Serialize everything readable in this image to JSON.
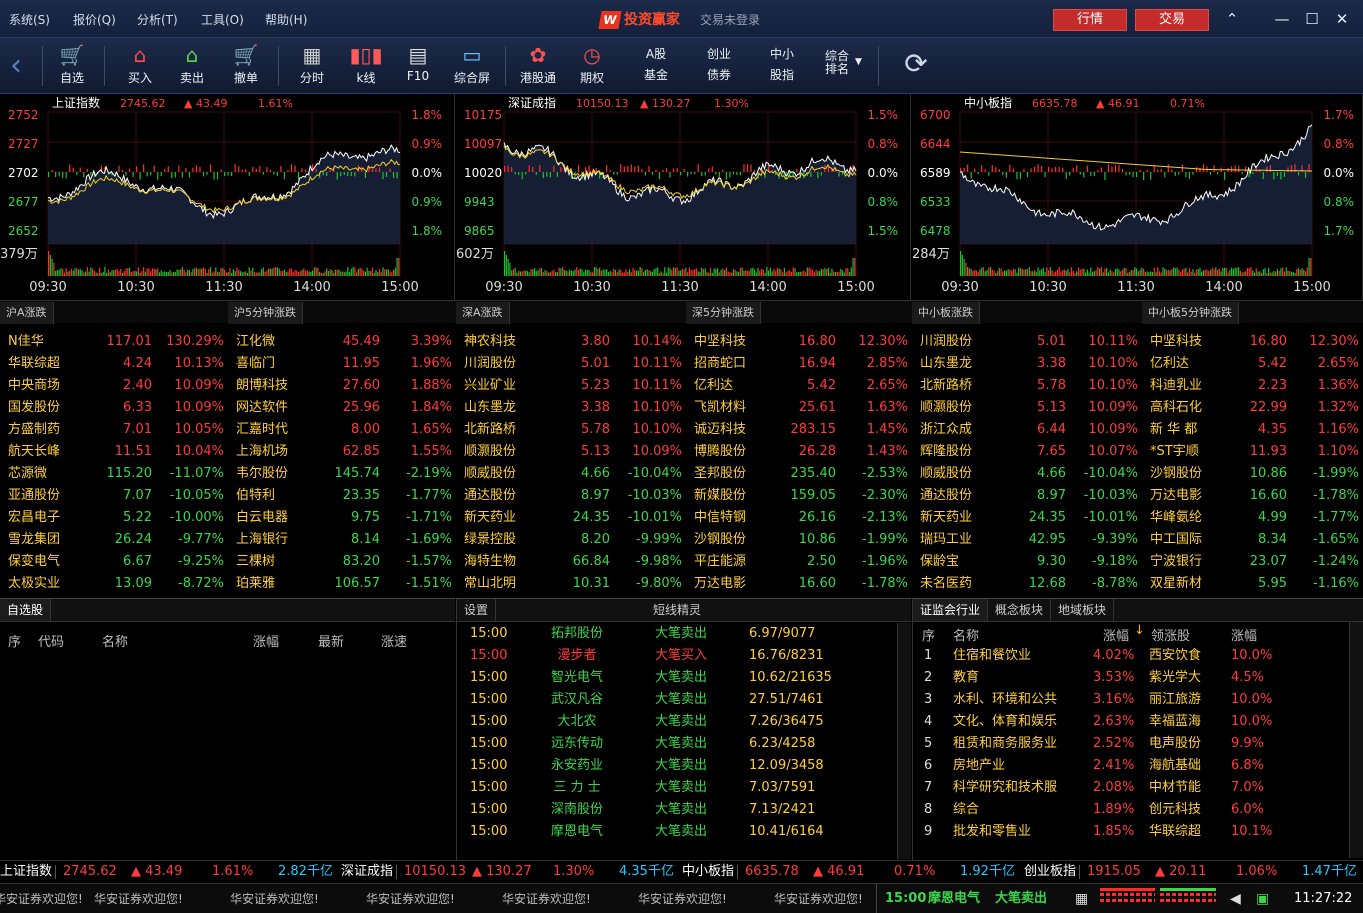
{
  "menu": [
    "系统(S)",
    "报价(Q)",
    "分析(T)",
    "工具(O)",
    "帮助(H)"
  ],
  "app_title": "投资赢家",
  "login_status": "交易未登录",
  "top_buttons": {
    "quote": "行情",
    "trade": "交易"
  },
  "toolbar": {
    "zixuan": "自选",
    "buy": "买入",
    "sell": "卖出",
    "cancel": "撤单",
    "fenshi": "分时",
    "kline": "k线",
    "f10": "F10",
    "zonghe": "综合屏",
    "ganggu": "港股通",
    "qiquan": "期权",
    "a_fund_1": "A股",
    "a_fund_2": "基金",
    "cy_1": "创业",
    "cy_2": "债券",
    "zx_1": "中小",
    "zx_2": "股指",
    "zh_1": "综合",
    "zh_2": "排名"
  },
  "charts": [
    {
      "name": "上证指数",
      "value": "2745.62",
      "change": "▲ 43.49",
      "pct": "1.61%",
      "left_ticks": [
        "2752",
        "2727",
        "2702",
        "2677",
        "2652"
      ],
      "right_ticks": [
        "1.8%",
        "0.9%",
        "0.0%",
        "0.9%",
        "1.8%"
      ],
      "volume": "379万",
      "times": [
        "09:30",
        "10:30",
        "11:30",
        "14:00",
        "15:00"
      ]
    },
    {
      "name": "深证成指",
      "value": "10150.13",
      "change": "▲ 130.27",
      "pct": "1.30%",
      "left_ticks": [
        "10175",
        "10097",
        "10020",
        "9943",
        "9865"
      ],
      "right_ticks": [
        "1.5%",
        "0.8%",
        "0.0%",
        "0.8%",
        "1.5%"
      ],
      "volume": "602万",
      "times": [
        "09:30",
        "10:30",
        "11:30",
        "14:00",
        "15:00"
      ]
    },
    {
      "name": "中小板指",
      "value": "6635.78",
      "change": "▲ 46.91",
      "pct": "0.71%",
      "left_ticks": [
        "6700",
        "6644",
        "6589",
        "6533",
        "6478"
      ],
      "right_ticks": [
        "1.7%",
        "0.8%",
        "0.0%",
        "0.8%",
        "1.7%"
      ],
      "volume": "284万",
      "times": [
        "09:30",
        "10:30",
        "11:30",
        "14:00",
        "15:00"
      ]
    }
  ],
  "tables": [
    {
      "title": "沪A涨跌",
      "rows": [
        [
          "N佳华",
          "117.01",
          "130.29%",
          "up"
        ],
        [
          "华联综超",
          "4.24",
          "10.13%",
          "up"
        ],
        [
          "中央商场",
          "2.40",
          "10.09%",
          "up"
        ],
        [
          "国发股份",
          "6.33",
          "10.09%",
          "up"
        ],
        [
          "方盛制药",
          "7.01",
          "10.05%",
          "up"
        ],
        [
          "航天长峰",
          "11.51",
          "10.04%",
          "up"
        ],
        [
          "芯源微",
          "115.20",
          "-11.07%",
          "dn"
        ],
        [
          "亚通股份",
          "7.07",
          "-10.05%",
          "dn"
        ],
        [
          "宏昌电子",
          "5.22",
          "-10.00%",
          "dn"
        ],
        [
          "雪龙集团",
          "26.24",
          "-9.77%",
          "dn"
        ],
        [
          "保变电气",
          "6.67",
          "-9.25%",
          "dn"
        ],
        [
          "太极实业",
          "13.09",
          "-8.72%",
          "dn"
        ]
      ]
    },
    {
      "title": "沪5分钟涨跌",
      "rows": [
        [
          "江化微",
          "45.49",
          "3.39%",
          "up"
        ],
        [
          "喜临门",
          "11.95",
          "1.96%",
          "up"
        ],
        [
          "朗博科技",
          "27.60",
          "1.88%",
          "up"
        ],
        [
          "网达软件",
          "25.96",
          "1.84%",
          "up"
        ],
        [
          "汇嘉时代",
          "8.00",
          "1.65%",
          "up"
        ],
        [
          "上海机场",
          "62.85",
          "1.55%",
          "up"
        ],
        [
          "韦尔股份",
          "145.74",
          "-2.19%",
          "dn"
        ],
        [
          "伯特利",
          "23.35",
          "-1.77%",
          "dn"
        ],
        [
          "白云电器",
          "9.75",
          "-1.71%",
          "dn"
        ],
        [
          "上海银行",
          "8.14",
          "-1.69%",
          "dn"
        ],
        [
          "三棵树",
          "83.20",
          "-1.57%",
          "dn"
        ],
        [
          "珀莱雅",
          "106.57",
          "-1.51%",
          "dn"
        ]
      ]
    },
    {
      "title": "深A涨跌",
      "rows": [
        [
          "神农科技",
          "3.80",
          "10.14%",
          "up"
        ],
        [
          "川润股份",
          "5.01",
          "10.11%",
          "up"
        ],
        [
          "兴业矿业",
          "5.23",
          "10.11%",
          "up"
        ],
        [
          "山东墨龙",
          "3.38",
          "10.10%",
          "up"
        ],
        [
          "北新路桥",
          "5.78",
          "10.10%",
          "up"
        ],
        [
          "顺灏股份",
          "5.13",
          "10.09%",
          "up"
        ],
        [
          "顺威股份",
          "4.66",
          "-10.04%",
          "dn"
        ],
        [
          "通达股份",
          "8.97",
          "-10.03%",
          "dn"
        ],
        [
          "新天药业",
          "24.35",
          "-10.01%",
          "dn"
        ],
        [
          "绿景控股",
          "8.20",
          "-9.99%",
          "dn"
        ],
        [
          "海特生物",
          "66.84",
          "-9.98%",
          "dn"
        ],
        [
          "常山北明",
          "10.31",
          "-9.80%",
          "dn"
        ]
      ]
    },
    {
      "title": "深5分钟涨跌",
      "rows": [
        [
          "中坚科技",
          "16.80",
          "12.30%",
          "up"
        ],
        [
          "招商蛇口",
          "16.94",
          "2.85%",
          "up"
        ],
        [
          "亿利达",
          "5.42",
          "2.65%",
          "up"
        ],
        [
          "飞凯材料",
          "25.61",
          "1.63%",
          "up"
        ],
        [
          "诚迈科技",
          "283.15",
          "1.45%",
          "up"
        ],
        [
          "博腾股份",
          "26.28",
          "1.43%",
          "up"
        ],
        [
          "圣邦股份",
          "235.40",
          "-2.53%",
          "dn"
        ],
        [
          "新媒股份",
          "159.05",
          "-2.30%",
          "dn"
        ],
        [
          "中信特钢",
          "26.16",
          "-2.13%",
          "dn"
        ],
        [
          "沙钢股份",
          "10.86",
          "-1.99%",
          "dn"
        ],
        [
          "平庄能源",
          "2.50",
          "-1.96%",
          "dn"
        ],
        [
          "万达电影",
          "16.60",
          "-1.78%",
          "dn"
        ]
      ]
    },
    {
      "title": "中小板涨跌",
      "rows": [
        [
          "川润股份",
          "5.01",
          "10.11%",
          "up"
        ],
        [
          "山东墨龙",
          "3.38",
          "10.10%",
          "up"
        ],
        [
          "北新路桥",
          "5.78",
          "10.10%",
          "up"
        ],
        [
          "顺灏股份",
          "5.13",
          "10.09%",
          "up"
        ],
        [
          "浙江众成",
          "6.44",
          "10.09%",
          "up"
        ],
        [
          "辉隆股份",
          "7.65",
          "10.07%",
          "up"
        ],
        [
          "顺威股份",
          "4.66",
          "-10.04%",
          "dn"
        ],
        [
          "通达股份",
          "8.97",
          "-10.03%",
          "dn"
        ],
        [
          "新天药业",
          "24.35",
          "-10.01%",
          "dn"
        ],
        [
          "瑞玛工业",
          "42.95",
          "-9.39%",
          "dn"
        ],
        [
          "保龄宝",
          "9.30",
          "-9.18%",
          "dn"
        ],
        [
          "未名医药",
          "12.68",
          "-8.78%",
          "dn"
        ]
      ]
    },
    {
      "title": "中小板5分钟涨跌",
      "rows": [
        [
          "中坚科技",
          "16.80",
          "12.30%",
          "up"
        ],
        [
          "亿利达",
          "5.42",
          "2.65%",
          "up"
        ],
        [
          "科迪乳业",
          "2.23",
          "1.36%",
          "up"
        ],
        [
          "高科石化",
          "22.99",
          "1.32%",
          "up"
        ],
        [
          "新 华 都",
          "4.35",
          "1.16%",
          "up"
        ],
        [
          "*ST宇顺",
          "11.93",
          "1.10%",
          "up"
        ],
        [
          "沙钢股份",
          "10.86",
          "-1.99%",
          "dn"
        ],
        [
          "万达电影",
          "16.60",
          "-1.78%",
          "dn"
        ],
        [
          "华峰氨纶",
          "4.99",
          "-1.77%",
          "dn"
        ],
        [
          "中工国际",
          "8.34",
          "-1.65%",
          "dn"
        ],
        [
          "宁波银行",
          "23.07",
          "-1.24%",
          "dn"
        ],
        [
          "双星新材",
          "5.95",
          "-1.16%",
          "dn"
        ]
      ]
    }
  ],
  "watchlist": {
    "tab": "自选股",
    "headers": [
      "序",
      "代码",
      "名称",
      "涨幅",
      "最新",
      "涨速"
    ]
  },
  "short_line": {
    "tab_settings": "设置",
    "title": "短线精灵",
    "rows": [
      [
        "15:00",
        "拓邦股份",
        "大笔卖出",
        "6.97/9077",
        "dn"
      ],
      [
        "15:00",
        "漫步者",
        "大笔买入",
        "16.76/8231",
        "up"
      ],
      [
        "15:00",
        "智光电气",
        "大笔卖出",
        "10.62/21635",
        "dn"
      ],
      [
        "15:00",
        "武汉凡谷",
        "大笔卖出",
        "27.51/7461",
        "dn"
      ],
      [
        "15:00",
        "大北农",
        "大笔卖出",
        "7.26/36475",
        "dn"
      ],
      [
        "15:00",
        "远东传动",
        "大笔卖出",
        "6.23/4258",
        "dn"
      ],
      [
        "15:00",
        "永安药业",
        "大笔卖出",
        "12.09/3458",
        "dn"
      ],
      [
        "15:00",
        "三 力 士",
        "大笔卖出",
        "7.03/7591",
        "dn"
      ],
      [
        "15:00",
        "深南股份",
        "大笔卖出",
        "7.13/2421",
        "dn"
      ],
      [
        "15:00",
        "摩恩电气",
        "大笔卖出",
        "10.41/6164",
        "dn"
      ]
    ]
  },
  "industry": {
    "tabs": [
      "证监会行业",
      "概念板块",
      "地域板块"
    ],
    "headers": [
      "序",
      "名称",
      "涨幅",
      "领涨股",
      "涨幅"
    ],
    "sort_icon": "↓",
    "rows": [
      [
        "1",
        "住宿和餐饮业",
        "4.02%",
        "西安饮食",
        "10.0%"
      ],
      [
        "2",
        "教育",
        "3.53%",
        "紫光学大",
        "4.5%"
      ],
      [
        "3",
        "水利、环境和公共",
        "3.16%",
        "丽江旅游",
        "10.0%"
      ],
      [
        "4",
        "文化、体育和娱乐",
        "2.63%",
        "幸福蓝海",
        "10.0%"
      ],
      [
        "5",
        "租赁和商务服务业",
        "2.52%",
        "电声股份",
        "9.9%"
      ],
      [
        "6",
        "房地产业",
        "2.41%",
        "海航基础",
        "6.8%"
      ],
      [
        "7",
        "科学研究和技术服",
        "2.08%",
        "中材节能",
        "7.0%"
      ],
      [
        "8",
        "综合",
        "1.89%",
        "创元科技",
        "6.0%"
      ],
      [
        "9",
        "批发和零售业",
        "1.85%",
        "华联综超",
        "10.1%"
      ]
    ]
  },
  "ticker": [
    {
      "name": "上证指数",
      "value": "2745.62",
      "change": "▲ 43.49",
      "pct": "1.61%",
      "amount": "2.82千亿"
    },
    {
      "name": "深证成指",
      "value": "10150.13",
      "change": "▲ 130.27",
      "pct": "1.30%",
      "amount": "4.35千亿"
    },
    {
      "name": "中小板指",
      "value": "6635.78",
      "change": "▲ 46.91",
      "pct": "0.71%",
      "amount": "1.92千亿"
    },
    {
      "name": "创业板指",
      "value": "1915.05",
      "change": "▲ 20.11",
      "pct": "1.06%",
      "amount": "1.47千亿"
    }
  ],
  "status": {
    "welcome": "华安证券欢迎您!",
    "latest_time": "15:00",
    "latest_stock": "摩恩电气",
    "latest_action": "大笔卖出",
    "clock": "11:27:22"
  }
}
